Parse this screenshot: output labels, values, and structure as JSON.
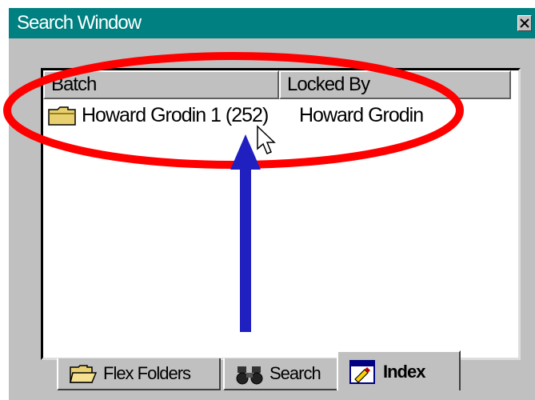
{
  "window": {
    "title": "Search Window"
  },
  "list": {
    "columns": [
      "Batch",
      "Locked By"
    ],
    "rows": [
      {
        "batch": "Howard Grodin 1 (252)",
        "locked_by": "Howard Grodin"
      }
    ]
  },
  "tabs": [
    {
      "label": "Flex Folders",
      "icon": "folder-open-icon"
    },
    {
      "label": "Search",
      "icon": "binoculars-icon"
    },
    {
      "label": "Index",
      "icon": "index-icon",
      "active": true
    }
  ],
  "annotation": {
    "ellipse_color": "#ff0000",
    "arrow_color": "#2020c0"
  }
}
